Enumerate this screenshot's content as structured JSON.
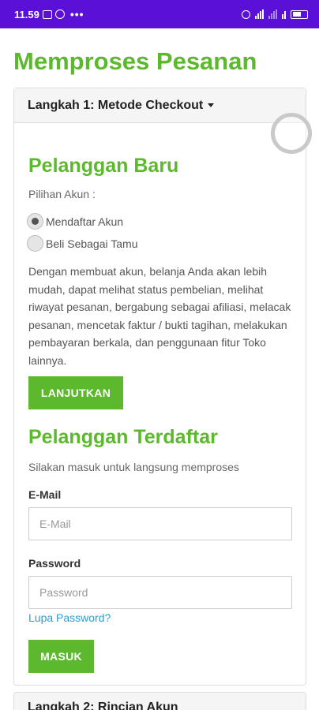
{
  "status_bar": {
    "time": "11.59",
    "dots": "•••"
  },
  "page_title": "Memproses Pesanan",
  "step1": {
    "heading": "Langkah 1: Metode Checkout"
  },
  "new_customer": {
    "title": "Pelanggan Baru",
    "account_options_label": "Pilihan Akun :",
    "options": [
      {
        "label": "Mendaftar Akun",
        "checked": true
      },
      {
        "label": "Beli Sebagai Tamu",
        "checked": false
      }
    ],
    "description": "Dengan membuat akun, belanja Anda akan lebih mudah, dapat melihat status pembelian, melihat riwayat pesanan, bergabung sebagai afiliasi, melacak pesanan, mencetak faktur / bukti tagihan, melakukan pembayaran berkala, dan penggunaan fitur Toko lainnya.",
    "continue_label": "LANJUTKAN"
  },
  "registered_customer": {
    "title": "Pelanggan Terdaftar",
    "subtitle": "Silakan masuk untuk langsung memproses",
    "email_label": "E-Mail",
    "email_placeholder": "E-Mail",
    "password_label": "Password",
    "password_placeholder": "Password",
    "forgot_link": "Lupa Password?",
    "login_label": "MASUK"
  },
  "step2": {
    "heading": "Langkah 2: Rincian Akun"
  },
  "colors": {
    "status_bar": "#5b10d8",
    "accent_green": "#5cb82d",
    "link_blue": "#2a9fd6"
  }
}
